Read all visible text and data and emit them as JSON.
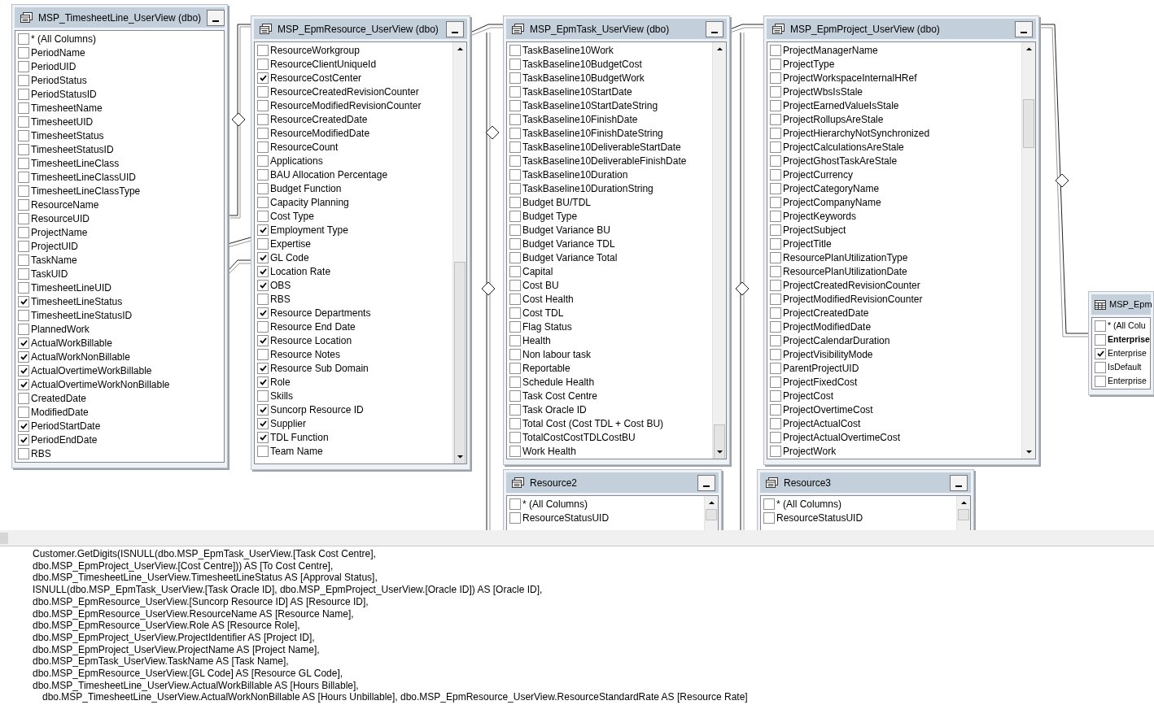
{
  "tables": [
    {
      "title": "MSP_TimesheetLine_UserView (dbo)",
      "kind": "view",
      "columns": [
        {
          "name": "* (All Columns)",
          "checked": false
        },
        {
          "name": "PeriodName",
          "checked": false
        },
        {
          "name": "PeriodUID",
          "checked": false
        },
        {
          "name": "PeriodStatus",
          "checked": false
        },
        {
          "name": "PeriodStatusID",
          "checked": false
        },
        {
          "name": "TimesheetName",
          "checked": false
        },
        {
          "name": "TimesheetUID",
          "checked": false
        },
        {
          "name": "TimesheetStatus",
          "checked": false
        },
        {
          "name": "TimesheetStatusID",
          "checked": false
        },
        {
          "name": "TimesheetLineClass",
          "checked": false
        },
        {
          "name": "TimesheetLineClassUID",
          "checked": false
        },
        {
          "name": "TimesheetLineClassType",
          "checked": false
        },
        {
          "name": "ResourceName",
          "checked": false
        },
        {
          "name": "ResourceUID",
          "checked": false
        },
        {
          "name": "ProjectName",
          "checked": false
        },
        {
          "name": "ProjectUID",
          "checked": false
        },
        {
          "name": "TaskName",
          "checked": false
        },
        {
          "name": "TaskUID",
          "checked": false
        },
        {
          "name": "TimesheetLineUID",
          "checked": false
        },
        {
          "name": "TimesheetLineStatus",
          "checked": true
        },
        {
          "name": "TimesheetLineStatusID",
          "checked": false
        },
        {
          "name": "PlannedWork",
          "checked": false
        },
        {
          "name": "ActualWorkBillable",
          "checked": true
        },
        {
          "name": "ActualWorkNonBillable",
          "checked": true
        },
        {
          "name": "ActualOvertimeWorkBillable",
          "checked": true
        },
        {
          "name": "ActualOvertimeWorkNonBillable",
          "checked": true
        },
        {
          "name": "CreatedDate",
          "checked": false
        },
        {
          "name": "ModifiedDate",
          "checked": false
        },
        {
          "name": "PeriodStartDate",
          "checked": true
        },
        {
          "name": "PeriodEndDate",
          "checked": true
        },
        {
          "name": "RBS",
          "checked": false
        }
      ]
    },
    {
      "title": "MSP_EpmResource_UserView (dbo)",
      "kind": "view",
      "columns": [
        {
          "name": "ResourceWorkgroup",
          "checked": false
        },
        {
          "name": "ResourceClientUniqueId",
          "checked": false
        },
        {
          "name": "ResourceCostCenter",
          "checked": true
        },
        {
          "name": "ResourceCreatedRevisionCounter",
          "checked": false
        },
        {
          "name": "ResourceModifiedRevisionCounter",
          "checked": false
        },
        {
          "name": "ResourceCreatedDate",
          "checked": false
        },
        {
          "name": "ResourceModifiedDate",
          "checked": false
        },
        {
          "name": "ResourceCount",
          "checked": false
        },
        {
          "name": "Applications",
          "checked": false
        },
        {
          "name": "BAU Allocation Percentage",
          "checked": false
        },
        {
          "name": "Budget Function",
          "checked": false
        },
        {
          "name": "Capacity Planning",
          "checked": false
        },
        {
          "name": "Cost Type",
          "checked": false
        },
        {
          "name": "Employment Type",
          "checked": true
        },
        {
          "name": "Expertise",
          "checked": false
        },
        {
          "name": "GL Code",
          "checked": true
        },
        {
          "name": "Location Rate",
          "checked": true
        },
        {
          "name": "OBS",
          "checked": true
        },
        {
          "name": "RBS",
          "checked": false
        },
        {
          "name": "Resource Departments",
          "checked": true
        },
        {
          "name": "Resource End Date",
          "checked": false
        },
        {
          "name": "Resource Location",
          "checked": true
        },
        {
          "name": "Resource Notes",
          "checked": false
        },
        {
          "name": "Resource Sub Domain",
          "checked": true
        },
        {
          "name": "Role",
          "checked": true
        },
        {
          "name": "Skills",
          "checked": false
        },
        {
          "name": "Suncorp Resource ID",
          "checked": true
        },
        {
          "name": "Supplier",
          "checked": true
        },
        {
          "name": "TDL Function",
          "checked": true
        },
        {
          "name": "Team Name",
          "checked": false
        }
      ]
    },
    {
      "title": "MSP_EpmTask_UserView (dbo)",
      "kind": "view",
      "columns": [
        {
          "name": "TaskBaseline10Work",
          "checked": false
        },
        {
          "name": "TaskBaseline10BudgetCost",
          "checked": false
        },
        {
          "name": "TaskBaseline10BudgetWork",
          "checked": false
        },
        {
          "name": "TaskBaseline10StartDate",
          "checked": false
        },
        {
          "name": "TaskBaseline10StartDateString",
          "checked": false
        },
        {
          "name": "TaskBaseline10FinishDate",
          "checked": false
        },
        {
          "name": "TaskBaseline10FinishDateString",
          "checked": false
        },
        {
          "name": "TaskBaseline10DeliverableStartDate",
          "checked": false
        },
        {
          "name": "TaskBaseline10DeliverableFinishDate",
          "checked": false
        },
        {
          "name": "TaskBaseline10Duration",
          "checked": false
        },
        {
          "name": "TaskBaseline10DurationString",
          "checked": false
        },
        {
          "name": "Budget BU/TDL",
          "checked": false
        },
        {
          "name": "Budget Type",
          "checked": false
        },
        {
          "name": "Budget Variance BU",
          "checked": false
        },
        {
          "name": "Budget Variance TDL",
          "checked": false
        },
        {
          "name": "Budget Variance Total",
          "checked": false
        },
        {
          "name": "Capital",
          "checked": false
        },
        {
          "name": "Cost BU",
          "checked": false
        },
        {
          "name": "Cost Health",
          "checked": false
        },
        {
          "name": "Cost TDL",
          "checked": false
        },
        {
          "name": "Flag Status",
          "checked": false
        },
        {
          "name": "Health",
          "checked": false
        },
        {
          "name": "Non labour task",
          "checked": false
        },
        {
          "name": "Reportable",
          "checked": false
        },
        {
          "name": "Schedule Health",
          "checked": false
        },
        {
          "name": "Task Cost Centre",
          "checked": false
        },
        {
          "name": "Task Oracle ID",
          "checked": false
        },
        {
          "name": "Total Cost (Cost TDL + Cost BU)",
          "checked": false
        },
        {
          "name": "TotalCostCostTDLCostBU",
          "checked": false
        },
        {
          "name": "Work Health",
          "checked": false
        }
      ]
    },
    {
      "title": "MSP_EpmProject_UserView (dbo)",
      "kind": "view",
      "columns": [
        {
          "name": "ProjectManagerName",
          "checked": false
        },
        {
          "name": "ProjectType",
          "checked": false
        },
        {
          "name": "ProjectWorkspaceInternalHRef",
          "checked": false
        },
        {
          "name": "ProjectWbsIsStale",
          "checked": false
        },
        {
          "name": "ProjectEarnedValueIsStale",
          "checked": false
        },
        {
          "name": "ProjectRollupsAreStale",
          "checked": false
        },
        {
          "name": "ProjectHierarchyNotSynchronized",
          "checked": false
        },
        {
          "name": "ProjectCalculationsAreStale",
          "checked": false
        },
        {
          "name": "ProjectGhostTaskAreStale",
          "checked": false
        },
        {
          "name": "ProjectCurrency",
          "checked": false
        },
        {
          "name": "ProjectCategoryName",
          "checked": false
        },
        {
          "name": "ProjectCompanyName",
          "checked": false
        },
        {
          "name": "ProjectKeywords",
          "checked": false
        },
        {
          "name": "ProjectSubject",
          "checked": false
        },
        {
          "name": "ProjectTitle",
          "checked": false
        },
        {
          "name": "ResourcePlanUtilizationType",
          "checked": false
        },
        {
          "name": "ResourcePlanUtilizationDate",
          "checked": false
        },
        {
          "name": "ProjectCreatedRevisionCounter",
          "checked": false
        },
        {
          "name": "ProjectModifiedRevisionCounter",
          "checked": false
        },
        {
          "name": "ProjectCreatedDate",
          "checked": false
        },
        {
          "name": "ProjectModifiedDate",
          "checked": false
        },
        {
          "name": "ProjectCalendarDuration",
          "checked": false
        },
        {
          "name": "ProjectVisibilityMode",
          "checked": false
        },
        {
          "name": "ParentProjectUID",
          "checked": false
        },
        {
          "name": "ProjectFixedCost",
          "checked": false
        },
        {
          "name": "ProjectCost",
          "checked": false
        },
        {
          "name": "ProjectOvertimeCost",
          "checked": false
        },
        {
          "name": "ProjectActualCost",
          "checked": false
        },
        {
          "name": "ProjectActualOvertimeCost",
          "checked": false
        },
        {
          "name": "ProjectWork",
          "checked": false
        }
      ]
    },
    {
      "title": "Resource2",
      "kind": "view",
      "columns": [
        {
          "name": "* (All Columns)",
          "checked": false
        },
        {
          "name": "ResourceStatusUID",
          "checked": false
        }
      ]
    },
    {
      "title": "Resource3",
      "kind": "view",
      "columns": [
        {
          "name": "* (All Columns)",
          "checked": false
        },
        {
          "name": "ResourceStatusUID",
          "checked": false
        }
      ]
    },
    {
      "title": "MSP_Epm",
      "kind": "table",
      "columns": [
        {
          "name": "* (All Colu",
          "checked": false,
          "primary_key": false
        },
        {
          "name": "Enterprise",
          "checked": false,
          "primary_key": true
        },
        {
          "name": "Enterprise",
          "checked": true,
          "primary_key": false
        },
        {
          "name": "IsDefault",
          "checked": false,
          "primary_key": false
        },
        {
          "name": "Enterprise",
          "checked": false,
          "primary_key": false
        }
      ]
    }
  ],
  "sql_lines": [
    {
      "text": "Customer.GetDigits(ISNULL(dbo.MSP_EpmTask_UserView.[Task Cost Centre],",
      "indented": false
    },
    {
      "text": "dbo.MSP_EpmProject_UserView.[Cost Centre])) AS [To Cost Centre],",
      "indented": false
    },
    {
      "text": "dbo.MSP_TimesheetLine_UserView.TimesheetLineStatus AS [Approval Status],",
      "indented": false
    },
    {
      "text": "ISNULL(dbo.MSP_EpmTask_UserView.[Task Oracle ID], dbo.MSP_EpmProject_UserView.[Oracle ID]) AS [Oracle ID],",
      "indented": false
    },
    {
      "text": "dbo.MSP_EpmResource_UserView.[Suncorp Resource ID] AS [Resource ID],",
      "indented": false
    },
    {
      "text": "dbo.MSP_EpmResource_UserView.ResourceName AS [Resource Name],",
      "indented": false
    },
    {
      "text": "dbo.MSP_EpmResource_UserView.Role AS [Resource Role],",
      "indented": false
    },
    {
      "text": "dbo.MSP_EpmProject_UserView.ProjectIdentifier AS [Project ID],",
      "indented": false
    },
    {
      "text": "dbo.MSP_EpmProject_UserView.ProjectName AS [Project Name],",
      "indented": false
    },
    {
      "text": "dbo.MSP_EpmTask_UserView.TaskName AS [Task Name],",
      "indented": false
    },
    {
      "text": "dbo.MSP_EpmResource_UserView.[GL Code] AS [Resource GL Code],",
      "indented": false
    },
    {
      "text": "dbo.MSP_TimesheetLine_UserView.ActualWorkBillable AS [Hours Billable],",
      "indented": false
    },
    {
      "text": "dbo.MSP_TimesheetLine_UserView.ActualWorkNonBillable AS [Hours Unbillable], dbo.MSP_EpmResource_UserView.ResourceStandardRate AS [Resource Rate]",
      "indented": true
    }
  ]
}
